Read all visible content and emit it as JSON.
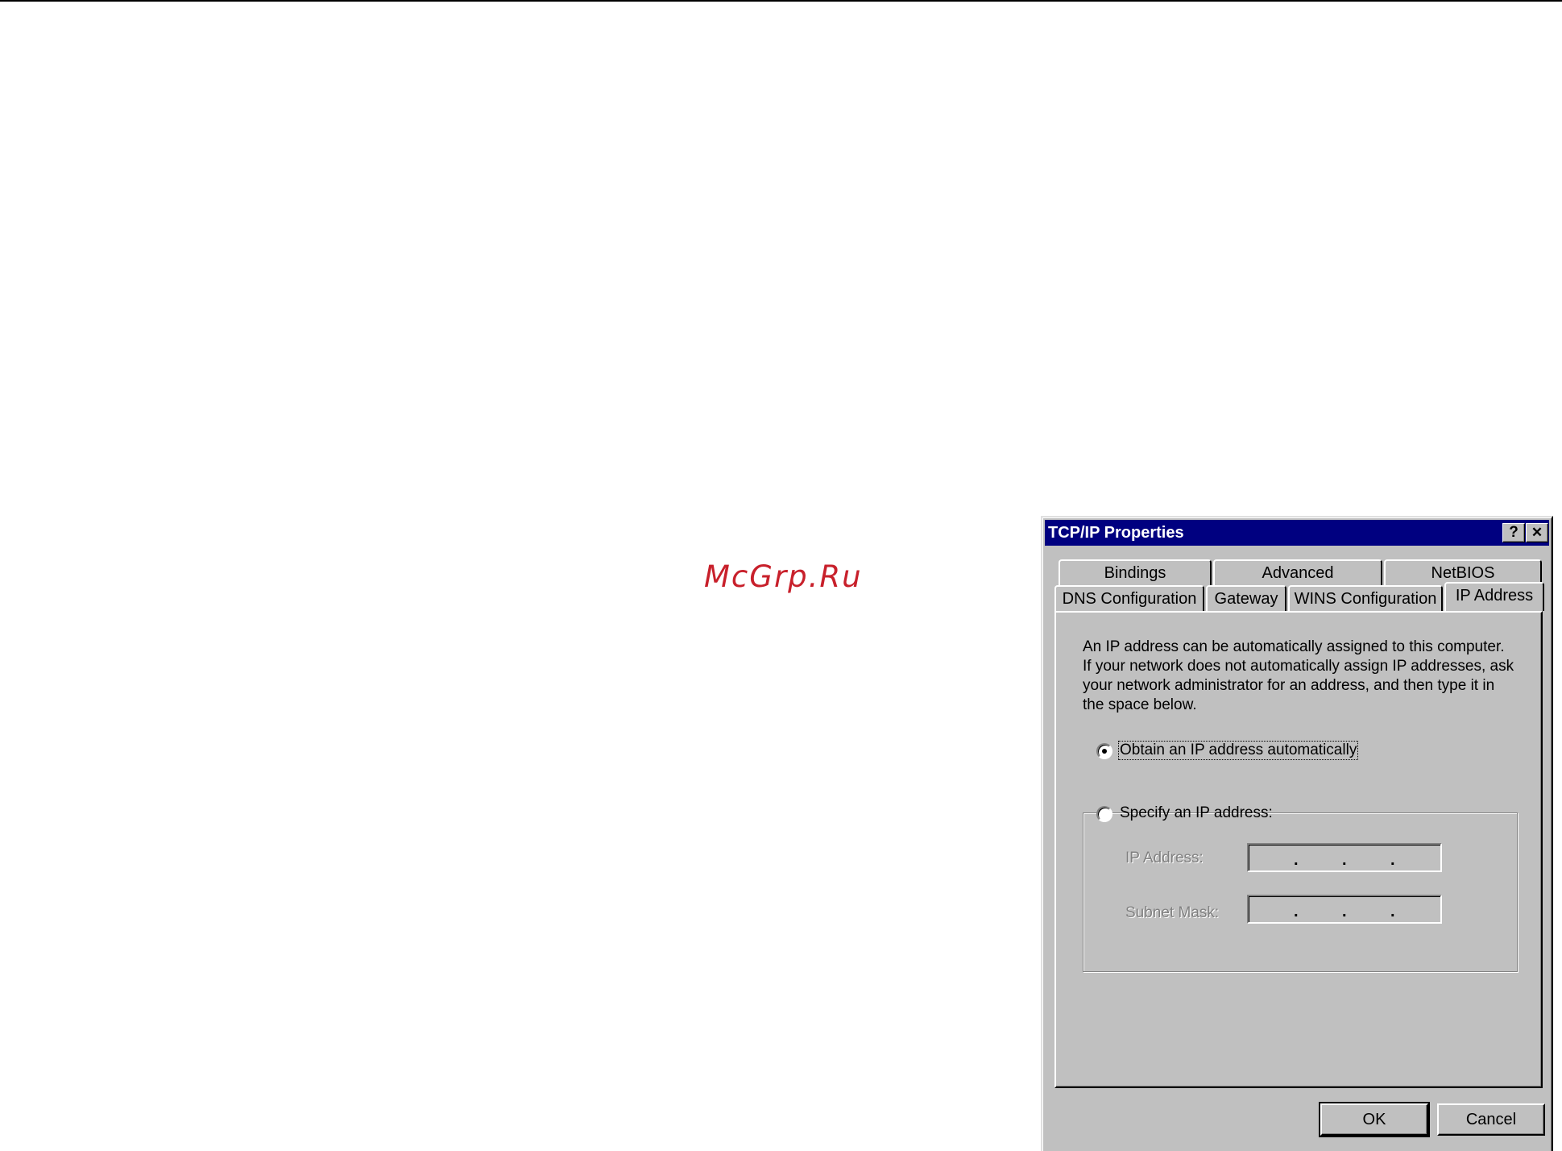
{
  "watermark": "McGrp.Ru",
  "dialog": {
    "title": "TCP/IP Properties",
    "help_button": "?",
    "close_button": "✕",
    "tabs_back": [
      "Bindings",
      "Advanced",
      "NetBIOS"
    ],
    "tabs_front": [
      "DNS Configuration",
      "Gateway",
      "WINS Configuration",
      "IP Address"
    ],
    "active_tab": "IP Address",
    "description": [
      "An IP address can be automatically assigned to this computer.",
      "If your network does not automatically assign IP addresses, ask",
      "your network administrator for an address, and then type it in",
      "the space below."
    ],
    "radio_obtain": "Obtain an IP address automatically",
    "radio_specify": "Specify an IP address:",
    "selected_option": "Obtain an IP address automatically",
    "ip_address_label": "IP Address:",
    "subnet_mask_label": "Subnet Mask:",
    "ip_address_value": "",
    "subnet_mask_value": "",
    "ok_button": "OK",
    "cancel_button": "Cancel"
  }
}
